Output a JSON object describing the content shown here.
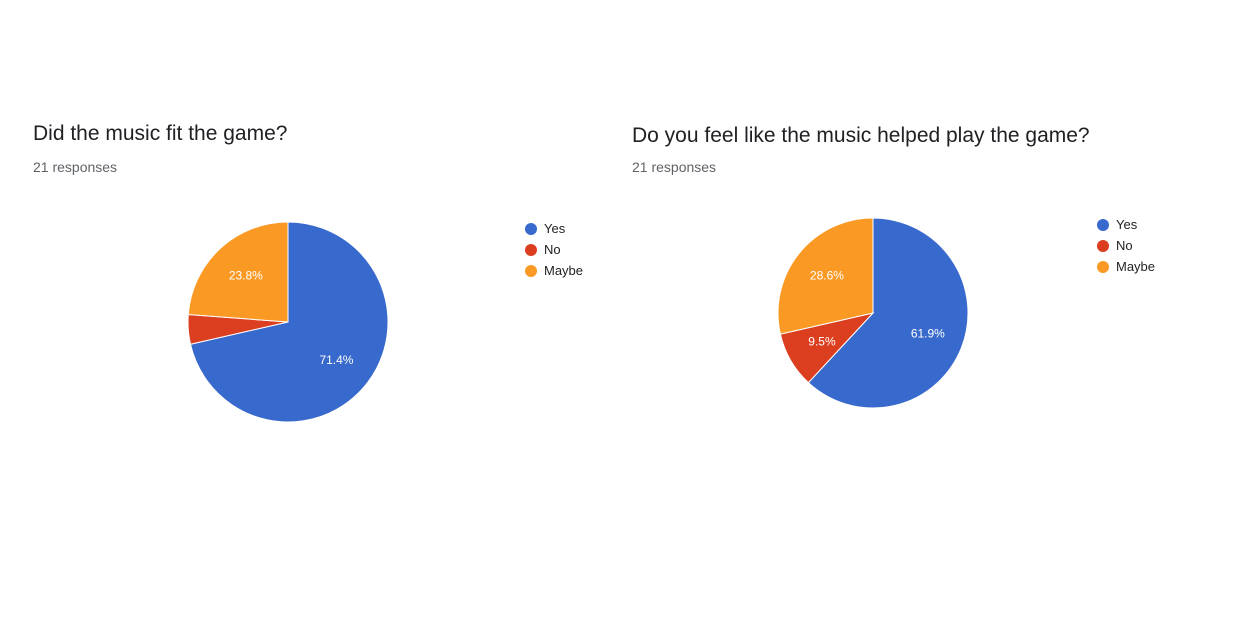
{
  "charts": [
    {
      "title": "Did the music fit the game?",
      "subtitle": "21 responses"
    },
    {
      "title": "Do you feel like the music helped play the game?",
      "subtitle": "21 responses"
    }
  ],
  "legend_colors": {
    "Yes": "#3869cc",
    "No": "#dc3e20",
    "Maybe": "#fa9a25"
  },
  "chart_data": [
    {
      "type": "pie",
      "title": "Did the music fit the game?",
      "categories": [
        "Yes",
        "No",
        "Maybe"
      ],
      "values": [
        15,
        1,
        5
      ],
      "labels": [
        "71.4%",
        "",
        "23.8%"
      ],
      "legend": "right"
    },
    {
      "type": "pie",
      "title": "Do you feel like the music helped play the game?",
      "categories": [
        "Yes",
        "No",
        "Maybe"
      ],
      "values": [
        13,
        2,
        6
      ],
      "labels": [
        "61.9%",
        "9.5%",
        "28.6%"
      ],
      "legend": "right"
    }
  ]
}
